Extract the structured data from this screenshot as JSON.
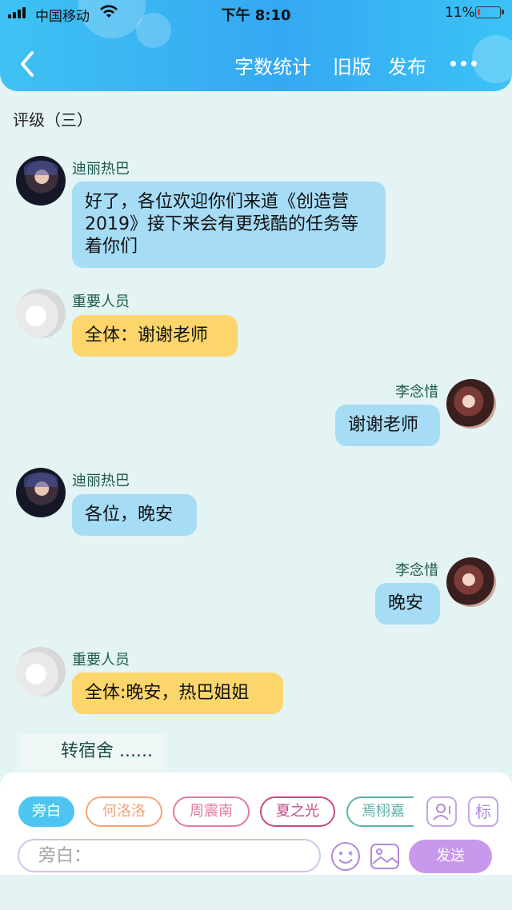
{
  "status_bar": {
    "carrier": "中国移动",
    "time": "下午 8:10",
    "battery_percent": "11%",
    "battery_level": 0.11
  },
  "header": {
    "back_icon": "chevron-left-icon",
    "links": [
      "字数统计",
      "旧版",
      "发布"
    ],
    "more_icon": "more-dots-icon"
  },
  "chat": {
    "section_title": "评级（三）",
    "messages": [
      {
        "sender": "迪丽热巴",
        "text": "好了，各位欢迎你们来道《创造营2019》接下来会有更残酷的任务等着你们",
        "side": "left",
        "bubble_color": "#a6dcf6",
        "avatar": "dark-portrait"
      },
      {
        "sender": "重要人员",
        "text": "全体：谢谢老师",
        "side": "left",
        "bubble_color": "#fcd66b",
        "avatar": "sky-clouds"
      },
      {
        "sender": "李念惜",
        "text": "谢谢老师",
        "side": "right",
        "bubble_color": "#a6dcf6",
        "avatar": "girl-portrait"
      },
      {
        "sender": "迪丽热巴",
        "text": "各位，晚安",
        "side": "left",
        "bubble_color": "#a6dcf6",
        "avatar": "dark-portrait"
      },
      {
        "sender": "李念惜",
        "text": "晚安",
        "side": "right",
        "bubble_color": "#a6dcf6",
        "avatar": "girl-portrait"
      },
      {
        "sender": "重要人员",
        "text": "全体:晚安，热巴姐姐",
        "side": "left",
        "bubble_color": "#fcd66b",
        "avatar": "sky-clouds"
      }
    ],
    "narration": "转宿舍 ......"
  },
  "composer": {
    "roles": [
      {
        "label": "旁白",
        "active": true,
        "color": "#4ec5f0"
      },
      {
        "label": "何洛洛",
        "active": false,
        "color": "#f0a67a"
      },
      {
        "label": "周震南",
        "active": false,
        "color": "#e57aa0"
      },
      {
        "label": "夏之光",
        "active": false,
        "color": "#c64a86"
      },
      {
        "label": "焉栩嘉",
        "active": false,
        "color": "#5bb3a8"
      }
    ],
    "role_manage_icon": "person-card-icon",
    "tag_label": "标",
    "input_placeholder": "旁白：",
    "emoji_icon": "emoji-icon",
    "image_icon": "image-icon",
    "send_label": "发送"
  }
}
